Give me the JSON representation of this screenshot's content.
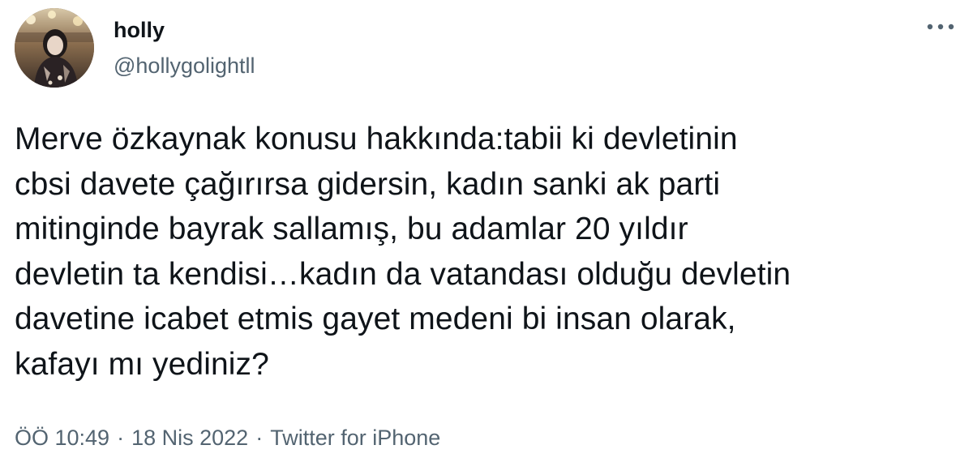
{
  "tweet": {
    "author": {
      "display_name": "holly",
      "handle": "@hollygolightll"
    },
    "text": "Merve özkaynak konusu hakkında:tabii ki devletinin\ncbsi davete çağırırsa gidersin, kadın sanki ak parti\nmitinginde bayrak sallamış, bu adamlar 20 yıldır\ndevletin ta kendisi…kadın da vatandası olduğu devletin\ndavetine icabet etmis gayet medeni bi insan olarak,\nkafayı mı yediniz?",
    "time": "ÖÖ 10:49",
    "separator": "·",
    "date": "18 Nis 2022",
    "source": "Twitter for iPhone"
  },
  "icons": {
    "more": "more-icon"
  },
  "colors": {
    "text": "#0f1419",
    "secondary": "#536471",
    "background": "#ffffff"
  }
}
